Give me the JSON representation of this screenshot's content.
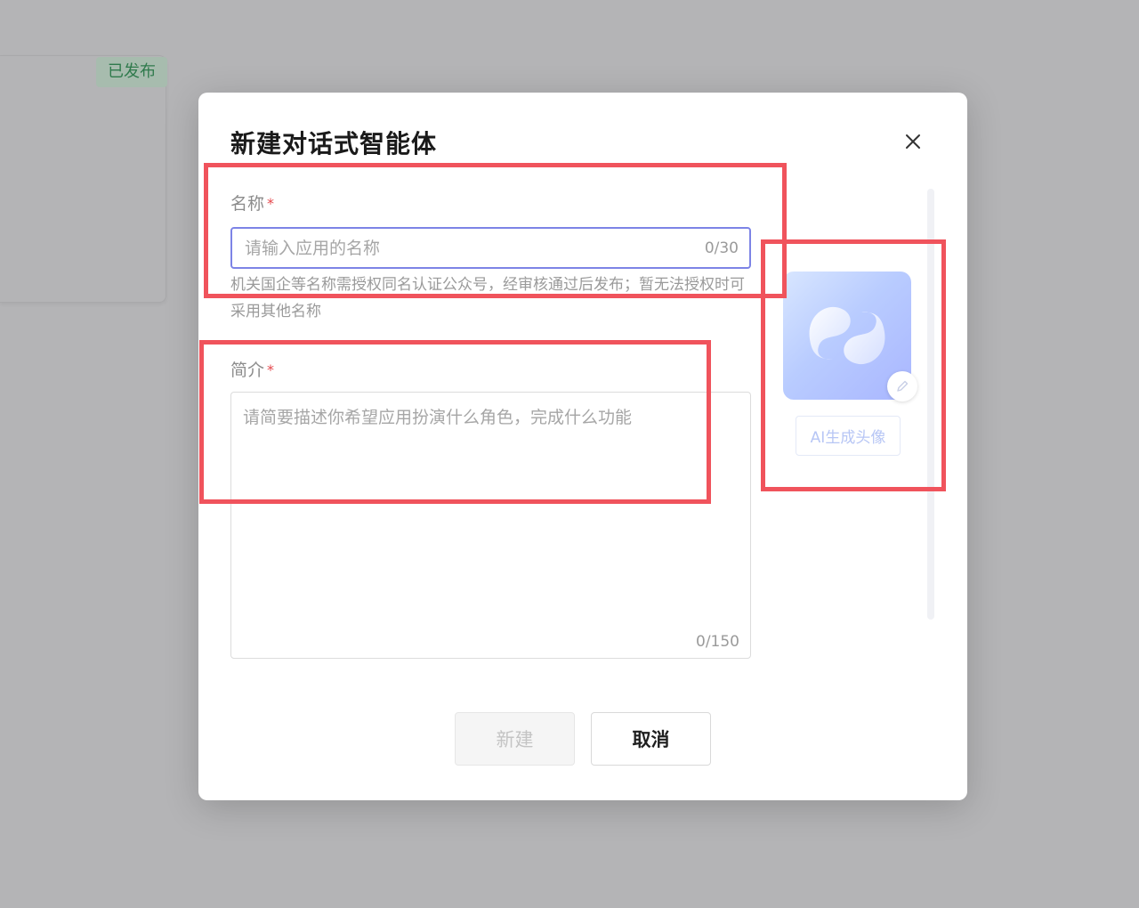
{
  "background": {
    "badge": "已发布"
  },
  "modal": {
    "title": "新建对话式智能体",
    "name": {
      "label": "名称",
      "required_mark": "*",
      "value": "",
      "placeholder": "请输入应用的名称",
      "count": "0/30",
      "hint": "机关国企等名称需授权同名认证公众号，经审核通过后发布；暂无法授权时可采用其他名称"
    },
    "description": {
      "label": "简介",
      "required_mark": "*",
      "value": "",
      "placeholder": "请简要描述你希望应用扮演什么角色，完成什么功能",
      "count": "0/150"
    },
    "avatar": {
      "ai_button_label": "AI生成头像"
    },
    "buttons": {
      "create_label": "新建",
      "cancel_label": "取消"
    }
  },
  "colors": {
    "accent": "#7d84e6",
    "annotation": "#f0535c",
    "required": "#e5484d",
    "badge_text": "#2f7a4c"
  }
}
